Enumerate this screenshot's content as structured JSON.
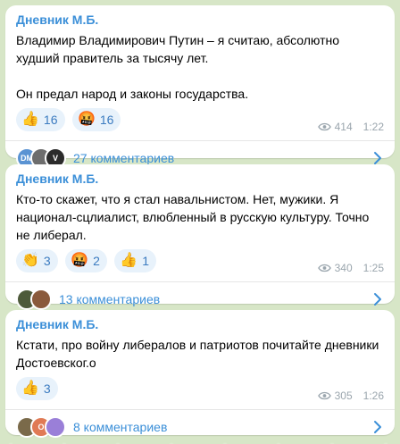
{
  "posts": [
    {
      "channel": "Дневник М.Б.",
      "text": "Владимир Владимирович Путин – я считаю, абсолютно худший правитель за тысячу лет.\n\nОн предал народ и законы государства.",
      "reactions": [
        {
          "emoji": "👍",
          "count": "16"
        },
        {
          "emoji": "🤬",
          "count": "16"
        }
      ],
      "views": "414",
      "time": "1:22",
      "comments_label": "27 комментариев",
      "avatars": [
        {
          "label": "DM",
          "color": "#5a93d3"
        },
        {
          "label": "",
          "color": "#6d6d6d"
        },
        {
          "label": "V",
          "color": "#2b2b2b"
        }
      ]
    },
    {
      "channel": "Дневник М.Б.",
      "text": "Кто-то скажет, что я стал навальнистом. Нет, мужики. Я национал-сцлиалист, влюбленный в русскую культуру. Точно не либерал.",
      "reactions": [
        {
          "emoji": "👏",
          "count": "3"
        },
        {
          "emoji": "🤬",
          "count": "2"
        },
        {
          "emoji": "👍",
          "count": "1"
        }
      ],
      "views": "340",
      "time": "1:25",
      "comments_label": "13 комментариев",
      "avatars": [
        {
          "label": "",
          "color": "#4d5a3a"
        },
        {
          "label": "",
          "color": "#8a5a3c"
        }
      ]
    },
    {
      "channel": "Дневник М.Б.",
      "text": "Кстати, про войну либералов и патриотов почитайте дневники Достоевског.о",
      "reactions": [
        {
          "emoji": "👍",
          "count": "3"
        }
      ],
      "views": "305",
      "time": "1:26",
      "comments_label": "8 комментариев",
      "avatars": [
        {
          "label": "",
          "color": "#7a6a4a"
        },
        {
          "label": "O",
          "color": "#e07a55"
        },
        {
          "label": "",
          "color": "#9a7fd8"
        }
      ]
    }
  ],
  "colors": {
    "accent": "#3b8fd8",
    "reaction_bg": "#e8f2fb",
    "meta": "#9aa5ad",
    "background": "#d7e6c7"
  }
}
